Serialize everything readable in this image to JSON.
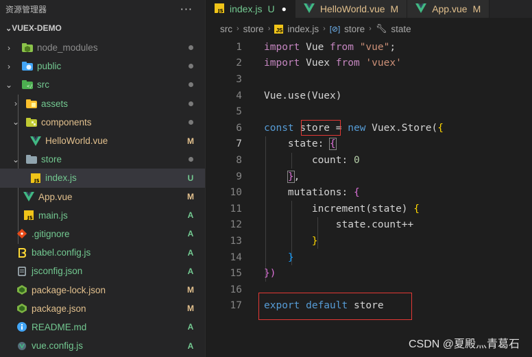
{
  "explorer": {
    "title": "资源管理器",
    "more": "···",
    "project": "VUEX-DEMO",
    "items": [
      {
        "label": "node_modules",
        "status": "dot",
        "type": "folder-node",
        "expanded": false,
        "color": "grey"
      },
      {
        "label": "public",
        "status": "dot",
        "type": "folder-public",
        "expanded": false,
        "color": "green"
      },
      {
        "label": "src",
        "status": "dot",
        "type": "folder-src",
        "expanded": true,
        "color": "green"
      },
      {
        "label": "assets",
        "status": "dot",
        "type": "folder-assets",
        "expanded": false,
        "color": "green"
      },
      {
        "label": "components",
        "status": "dot",
        "type": "folder-components",
        "expanded": true,
        "color": "yellow"
      },
      {
        "label": "HelloWorld.vue",
        "status": "M",
        "type": "vue",
        "color": "yellow"
      },
      {
        "label": "store",
        "status": "dot",
        "type": "folder-store",
        "expanded": true,
        "color": "green"
      },
      {
        "label": "index.js",
        "status": "U",
        "type": "js",
        "color": "green"
      },
      {
        "label": "App.vue",
        "status": "M",
        "type": "vue",
        "color": "yellow"
      },
      {
        "label": "main.js",
        "status": "A",
        "type": "js",
        "color": "green"
      },
      {
        "label": ".gitignore",
        "status": "A",
        "type": "git",
        "color": "green"
      },
      {
        "label": "babel.config.js",
        "status": "A",
        "type": "babel",
        "color": "green"
      },
      {
        "label": "jsconfig.json",
        "status": "A",
        "type": "jsconfig",
        "color": "green"
      },
      {
        "label": "package-lock.json",
        "status": "M",
        "type": "npm",
        "color": "yellow"
      },
      {
        "label": "package.json",
        "status": "M",
        "type": "npm",
        "color": "yellow"
      },
      {
        "label": "README.md",
        "status": "A",
        "type": "info",
        "color": "green"
      },
      {
        "label": "vue.config.js",
        "status": "A",
        "type": "vueconfig",
        "color": "green"
      }
    ]
  },
  "tabs": [
    {
      "label": "index.js",
      "status": "U",
      "icon": "JS",
      "dirty": "●"
    },
    {
      "label": "HelloWorld.vue",
      "status": "M",
      "icon": "V"
    },
    {
      "label": "App.vue",
      "status": "M",
      "icon": "V"
    }
  ],
  "breadcrumb": {
    "parts": [
      "src",
      "store",
      "index.js",
      "store",
      "state"
    ]
  },
  "code": {
    "line_numbers": [
      "1",
      "2",
      "3",
      "4",
      "5",
      "6",
      "7",
      "8",
      "9",
      "10",
      "11",
      "12",
      "13",
      "14",
      "15",
      "16",
      "17"
    ],
    "l1": {
      "a": "import",
      "b": " Vue ",
      "c": "from",
      "d": " \"vue\"",
      "e": ";"
    },
    "l2": {
      "a": "import",
      "b": " Vuex ",
      "c": "from",
      "d": " 'vuex'"
    },
    "l4": {
      "a": "Vue.use(Vuex)"
    },
    "l6": {
      "a": "const",
      "b": " store ",
      "c": "=",
      "d": " new",
      "e": " Vuex.Store(",
      "f": "{"
    },
    "l7": {
      "a": "state: ",
      "b": "{"
    },
    "l8": {
      "a": "count: ",
      "b": "0"
    },
    "l9": {
      "a": "}",
      "b": ","
    },
    "l10": {
      "a": "mutations: ",
      "b": "{"
    },
    "l11": {
      "a": "increment",
      "b": "(state) ",
      "c": "{"
    },
    "l12": {
      "a": "state.count++"
    },
    "l13": {
      "a": "}"
    },
    "l14": {
      "a": "}"
    },
    "l15": {
      "a": "})"
    },
    "l17": {
      "a": "export",
      "b": " default",
      "c": " store"
    }
  },
  "watermark": "CSDN @夏殿灬青葛石",
  "colors": {
    "modified": "#e2c08d",
    "added": "#73c991",
    "annotation_box": "#e53935"
  }
}
